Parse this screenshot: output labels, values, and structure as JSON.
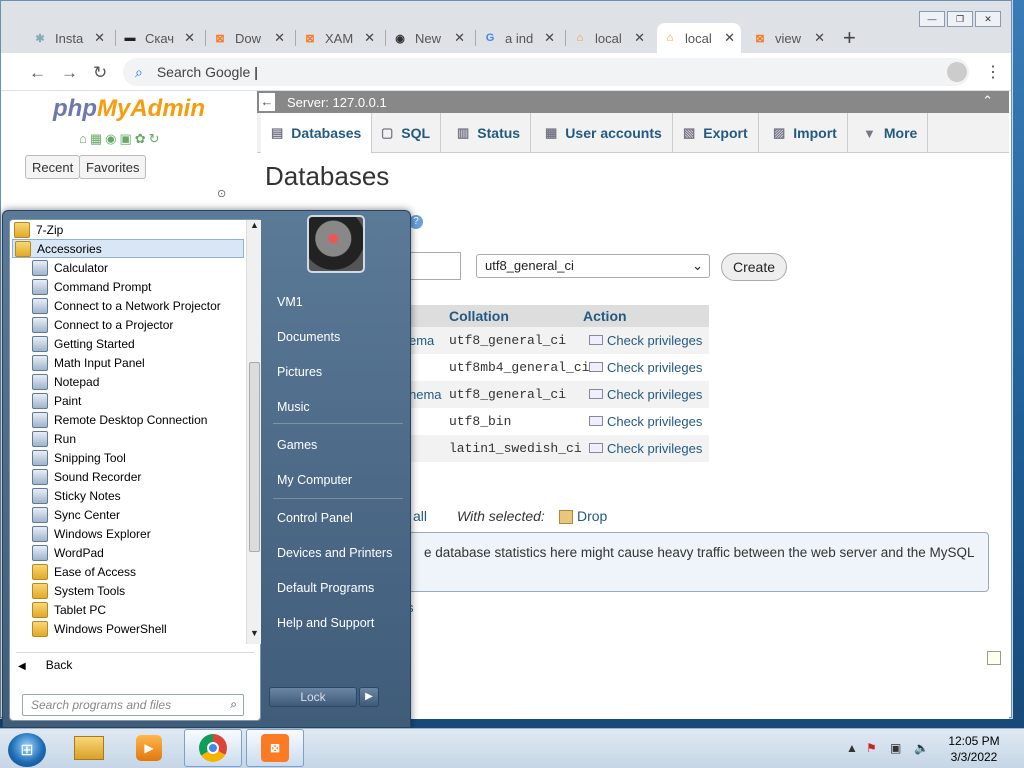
{
  "browser": {
    "tabs": [
      {
        "title": "Insta",
        "icon": "spark-icon"
      },
      {
        "title": "Скач",
        "icon": "monitor-icon"
      },
      {
        "title": "Dow",
        "icon": "xampp-icon"
      },
      {
        "title": "XAM",
        "icon": "xampp-icon"
      },
      {
        "title": "New",
        "icon": "github-icon"
      },
      {
        "title": "a ind",
        "icon": "google-icon"
      },
      {
        "title": "local",
        "icon": "pma-icon"
      },
      {
        "title": "local",
        "icon": "pma-icon"
      },
      {
        "title": "view",
        "icon": "xampp-icon"
      }
    ],
    "active_tab_index": 7,
    "omnibox_placeholder": "Search Google"
  },
  "pma": {
    "logo_text_a": "php",
    "logo_text_b": "MyAdmin",
    "recent_label": "Recent",
    "favorites_label": "Favorites",
    "server_label": "Server: 127.0.0.1",
    "nav_tabs": [
      "Databases",
      "SQL",
      "Status",
      "User accounts",
      "Export",
      "Import",
      "More"
    ],
    "page_title": "Databases",
    "collation_select": "utf8_general_ci",
    "create_label": "Create",
    "table_headers": {
      "collation": "Collation",
      "action": "Action"
    },
    "rows": [
      {
        "name_tail": "ema",
        "collation": "utf8_general_ci",
        "action": "Check privileges"
      },
      {
        "name_tail": "",
        "collation": "utf8mb4_general_ci",
        "action": "Check privileges"
      },
      {
        "name_tail": "hema",
        "collation": "utf8_general_ci",
        "action": "Check privileges"
      },
      {
        "name_tail": "",
        "collation": "utf8_bin",
        "action": "Check privileges"
      },
      {
        "name_tail": "",
        "collation": "latin1_swedish_ci",
        "action": "Check privileges"
      }
    ],
    "check_all_tail": "all",
    "with_selected": "With selected:",
    "drop_label": "Drop",
    "notice": "e database statistics here might cause heavy traffic between the web server and the MySQL",
    "stats_link_tail": "s"
  },
  "start_menu": {
    "programs": [
      {
        "label": "7-Zip",
        "type": "folder",
        "indent": 0
      },
      {
        "label": "Accessories",
        "type": "folder",
        "indent": 0,
        "selected": true
      },
      {
        "label": "Calculator",
        "type": "app",
        "indent": 1
      },
      {
        "label": "Command Prompt",
        "type": "app",
        "indent": 1
      },
      {
        "label": "Connect to a Network Projector",
        "type": "app",
        "indent": 1
      },
      {
        "label": "Connect to a Projector",
        "type": "app",
        "indent": 1
      },
      {
        "label": "Getting Started",
        "type": "app",
        "indent": 1
      },
      {
        "label": "Math Input Panel",
        "type": "app",
        "indent": 1
      },
      {
        "label": "Notepad",
        "type": "app",
        "indent": 1
      },
      {
        "label": "Paint",
        "type": "app",
        "indent": 1
      },
      {
        "label": "Remote Desktop Connection",
        "type": "app",
        "indent": 1
      },
      {
        "label": "Run",
        "type": "app",
        "indent": 1
      },
      {
        "label": "Snipping Tool",
        "type": "app",
        "indent": 1
      },
      {
        "label": "Sound Recorder",
        "type": "app",
        "indent": 1
      },
      {
        "label": "Sticky Notes",
        "type": "app",
        "indent": 1
      },
      {
        "label": "Sync Center",
        "type": "app",
        "indent": 1
      },
      {
        "label": "Windows Explorer",
        "type": "app",
        "indent": 1
      },
      {
        "label": "WordPad",
        "type": "app",
        "indent": 1
      },
      {
        "label": "Ease of Access",
        "type": "folder",
        "indent": 1
      },
      {
        "label": "System Tools",
        "type": "folder",
        "indent": 1
      },
      {
        "label": "Tablet PC",
        "type": "folder",
        "indent": 1
      },
      {
        "label": "Windows PowerShell",
        "type": "folder",
        "indent": 1
      }
    ],
    "back_label": "Back",
    "search_placeholder": "Search programs and files",
    "right_links": [
      "VM1",
      "Documents",
      "Pictures",
      "Music",
      "Games",
      "My Computer",
      "Control Panel",
      "Devices and Printers",
      "Default Programs",
      "Help and Support"
    ],
    "lock_label": "Lock"
  },
  "taskbar": {
    "time": "12:05 PM",
    "date": "3/3/2022"
  }
}
